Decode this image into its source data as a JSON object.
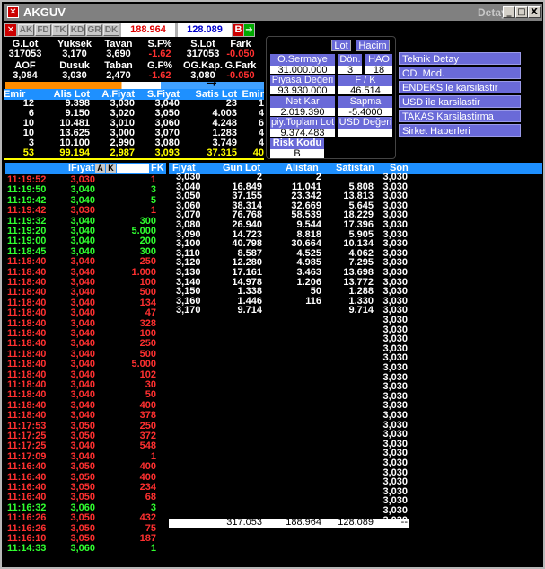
{
  "window": {
    "title": "AKGUV",
    "detay": "Detay",
    "min": "_",
    "max": "□",
    "close": "X"
  },
  "toolbar": {
    "buttons": [
      "AK",
      "FD",
      "TK",
      "KD",
      "GR",
      "DK"
    ],
    "price_red": "188.964",
    "price_blue": "128.089",
    "b_label": "B"
  },
  "summary": {
    "row1_headers": [
      "G.Lot",
      "Yuksek",
      "Tavan",
      "S.F%",
      "S.Lot",
      "Fark"
    ],
    "row1_values": [
      "317053",
      "3,170",
      "3,690",
      "-1.62",
      "317053",
      "-0.050"
    ],
    "row2_headers": [
      "AOF",
      "Dusuk",
      "Taban",
      "G.F%",
      "OG.Kap.",
      "G.Fark"
    ],
    "row2_values": [
      "3,084",
      "3,030",
      "2,470",
      "-1.62",
      "3,080",
      "-0.050"
    ],
    "arrow": "→"
  },
  "depth": {
    "headers": [
      "Emir",
      "Alis Lot",
      "A.Fiyat",
      "S.Fiyat",
      "Satis Lot",
      "Emir"
    ],
    "rows": [
      [
        "12",
        "9.398",
        "3,030",
        "3,040",
        "23",
        "1"
      ],
      [
        "6",
        "9.150",
        "3,020",
        "3,050",
        "4.003",
        "4"
      ],
      [
        "10",
        "10.481",
        "3,010",
        "3,060",
        "4.248",
        "6"
      ],
      [
        "10",
        "13.625",
        "3,000",
        "3,070",
        "1.283",
        "4"
      ],
      [
        "3",
        "10.100",
        "2,990",
        "3,080",
        "3.749",
        "4"
      ]
    ],
    "totals": [
      "53",
      "99.194",
      "2,987",
      "3,093",
      "37.315",
      "40"
    ]
  },
  "info": {
    "lot_btn": "Lot",
    "hacim_btn": "Hacim",
    "osermaye_label": "O.Sermaye",
    "osermaye_value": "31.000.000",
    "don_label": "Dön.",
    "don_value": "3",
    "hao_label": "HAO",
    "hao_value": "18",
    "piyasa_label": "Piyasa Değeri",
    "piyasa_value": "93.930.000",
    "fk_label": "F / K",
    "fk_value": "46.514",
    "netkar_label": "Net Kar",
    "netkar_value": "2.019.390",
    "sapma_label": "Sapma",
    "sapma_value": "-5.4000",
    "toplamlot_label": "piy.Toplam Lot",
    "toplamlot_value": "9.374.483",
    "usd_label": "USD Değeri",
    "usd_value": "",
    "risk_label": "Risk Kodu",
    "risk_value": "B"
  },
  "menu": [
    "Teknik Detay",
    "OD. Mod.",
    "ENDEKS le karsilastir",
    "USD ile karsilastir",
    "TAKAS Karsilastirma",
    "Sirket Haberleri"
  ],
  "trades": {
    "headers": {
      "fiyat": "IFiyat",
      "a": "A",
      "k": "K",
      "fk": "FK"
    },
    "rows": [
      [
        "11:19:52",
        "3,030",
        "1",
        "r"
      ],
      [
        "11:19:50",
        "3,040",
        "3",
        "g"
      ],
      [
        "11:19:42",
        "3,040",
        "5",
        "g"
      ],
      [
        "11:19:42",
        "3,030",
        "1",
        "r"
      ],
      [
        "11:19:32",
        "3,040",
        "300",
        "g"
      ],
      [
        "11:19:20",
        "3,040",
        "5.000",
        "g"
      ],
      [
        "11:19:00",
        "3,040",
        "200",
        "g"
      ],
      [
        "11:18:45",
        "3,040",
        "300",
        "g"
      ],
      [
        "11:18:40",
        "3,040",
        "250",
        "r"
      ],
      [
        "11:18:40",
        "3,040",
        "1.000",
        "r"
      ],
      [
        "11:18:40",
        "3,040",
        "100",
        "r"
      ],
      [
        "11:18:40",
        "3,040",
        "500",
        "r"
      ],
      [
        "11:18:40",
        "3,040",
        "134",
        "r"
      ],
      [
        "11:18:40",
        "3,040",
        "47",
        "r"
      ],
      [
        "11:18:40",
        "3,040",
        "328",
        "r"
      ],
      [
        "11:18:40",
        "3,040",
        "100",
        "r"
      ],
      [
        "11:18:40",
        "3,040",
        "250",
        "r"
      ],
      [
        "11:18:40",
        "3,040",
        "500",
        "r"
      ],
      [
        "11:18:40",
        "3,040",
        "5.000",
        "r"
      ],
      [
        "11:18:40",
        "3,040",
        "102",
        "r"
      ],
      [
        "11:18:40",
        "3,040",
        "30",
        "r"
      ],
      [
        "11:18:40",
        "3,040",
        "50",
        "r"
      ],
      [
        "11:18:40",
        "3,040",
        "400",
        "r"
      ],
      [
        "11:18:40",
        "3,040",
        "378",
        "r"
      ],
      [
        "11:17:53",
        "3,050",
        "250",
        "r"
      ],
      [
        "11:17:25",
        "3,050",
        "372",
        "r"
      ],
      [
        "11:17:25",
        "3,040",
        "548",
        "r"
      ],
      [
        "11:17:09",
        "3,040",
        "1",
        "r"
      ],
      [
        "11:16:40",
        "3,050",
        "400",
        "r"
      ],
      [
        "11:16:40",
        "3,050",
        "400",
        "r"
      ],
      [
        "11:16:40",
        "3,050",
        "234",
        "r"
      ],
      [
        "11:16:40",
        "3,050",
        "68",
        "r"
      ],
      [
        "11:16:32",
        "3,060",
        "3",
        "g"
      ],
      [
        "11:16:26",
        "3,050",
        "432",
        "r"
      ],
      [
        "11:16:26",
        "3,050",
        "75",
        "r"
      ],
      [
        "11:16:10",
        "3,050",
        "187",
        "r"
      ],
      [
        "11:14:33",
        "3,060",
        "1",
        "g"
      ]
    ]
  },
  "book": {
    "headers": [
      "Fiyat",
      "Gun Lot",
      "Alistan",
      "Satistan",
      "Son"
    ],
    "rows": [
      [
        "3,030",
        "2",
        "2",
        "",
        "3,030"
      ],
      [
        "3,040",
        "16.849",
        "11.041",
        "5.808",
        "3,030"
      ],
      [
        "3,050",
        "37.155",
        "23.342",
        "13.813",
        "3,030"
      ],
      [
        "3,060",
        "38.314",
        "32.669",
        "5.645",
        "3,030"
      ],
      [
        "3,070",
        "76.768",
        "58.539",
        "18.229",
        "3,030"
      ],
      [
        "3,080",
        "26.940",
        "9.544",
        "17.396",
        "3,030"
      ],
      [
        "3,090",
        "14.723",
        "8.818",
        "5.905",
        "3,030"
      ],
      [
        "3,100",
        "40.798",
        "30.664",
        "10.134",
        "3,030"
      ],
      [
        "3,110",
        "8.587",
        "4.525",
        "4.062",
        "3,030"
      ],
      [
        "3,120",
        "12.280",
        "4.985",
        "7.295",
        "3,030"
      ],
      [
        "3,130",
        "17.161",
        "3.463",
        "13.698",
        "3,030"
      ],
      [
        "3,140",
        "14.978",
        "1.206",
        "13.772",
        "3,030"
      ],
      [
        "3,150",
        "1.338",
        "50",
        "1.288",
        "3,030"
      ],
      [
        "3,160",
        "1.446",
        "116",
        "1.330",
        "3,030"
      ],
      [
        "3,170",
        "9.714",
        "",
        "9.714",
        "3,030"
      ]
    ],
    "son_extra": [
      "3,030",
      "3,030",
      "3,030",
      "3,030",
      "3,030",
      "3,030",
      "3,030",
      "3,030",
      "3,030",
      "3,030",
      "3,030",
      "3,030",
      "3,030",
      "3,030",
      "3,030",
      "3,030",
      "3,030",
      "3,030",
      "3,030",
      "3,030",
      "3,030",
      "3,030"
    ],
    "totals": [
      "317.053",
      "188.964",
      "128.089",
      "--"
    ]
  },
  "colors": {
    "up": "#30ff30",
    "down": "#ff3030",
    "header_blue": "#1e90ff",
    "panel": "#6a6ad8"
  }
}
